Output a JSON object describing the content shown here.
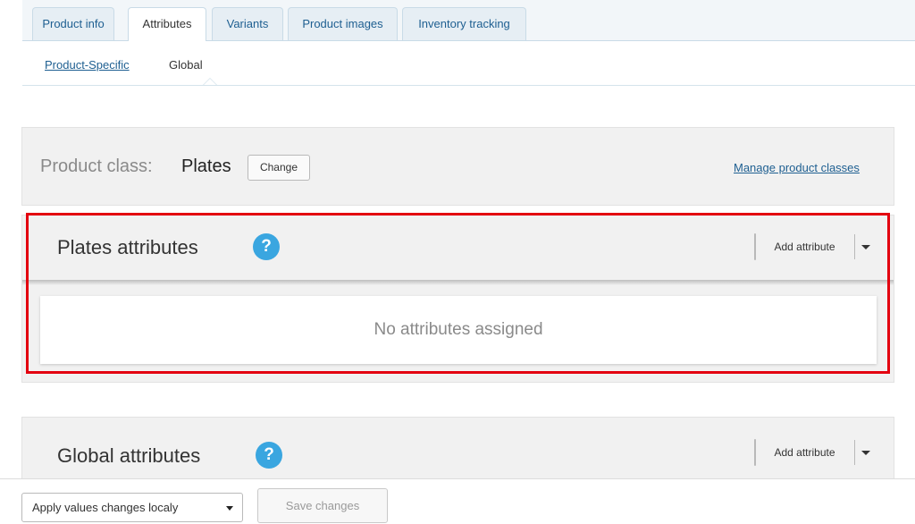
{
  "tabs": [
    {
      "label": "Product info"
    },
    {
      "label": "Attributes"
    },
    {
      "label": "Variants"
    },
    {
      "label": "Product images"
    },
    {
      "label": "Inventory tracking"
    }
  ],
  "subtabs": {
    "product_specific": "Product-Specific",
    "global": "Global"
  },
  "product_class": {
    "label": "Product class:",
    "value": "Plates",
    "change_label": "Change",
    "manage_link": "Manage product classes"
  },
  "plates_attributes": {
    "title": "Plates attributes",
    "help_glyph": "?",
    "add_label": "Add attribute",
    "empty_message": "No attributes assigned"
  },
  "global_attributes": {
    "title": "Global attributes",
    "help_glyph": "?",
    "add_label": "Add attribute"
  },
  "footer": {
    "apply_select_value": "Apply values changes localy",
    "save_label": "Save changes"
  },
  "colors": {
    "link": "#1e5f91",
    "help_icon": "#3aa6e0",
    "highlight": "#e3000f"
  },
  "icons": [
    "help-icon",
    "chevron-down-icon"
  ]
}
